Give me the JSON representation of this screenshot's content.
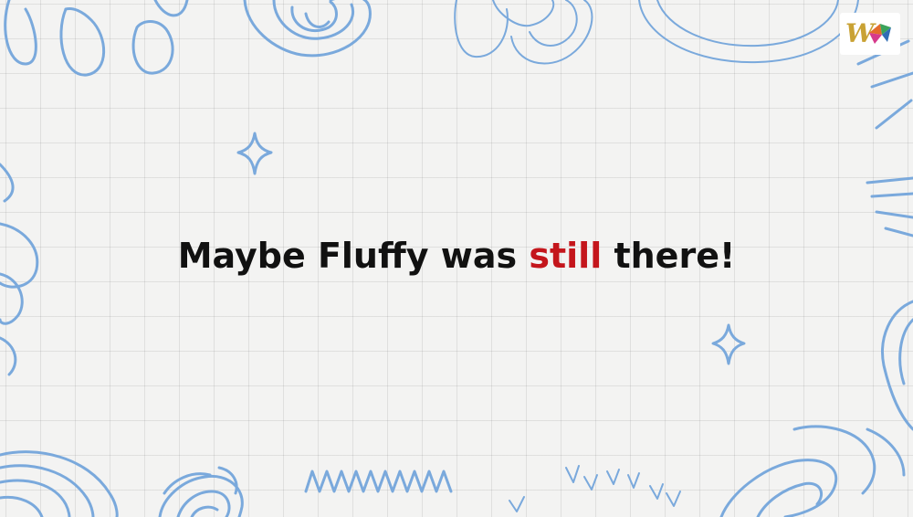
{
  "slide": {
    "text_before": "Maybe Fluffy was ",
    "text_highlight": "still",
    "text_after": " there!",
    "text_color": "#111111",
    "highlight_color": "#c4161c",
    "background_color": "#f3f3f2",
    "doodle_color": "#7aa9dc"
  },
  "logo": {
    "letter": "W"
  }
}
